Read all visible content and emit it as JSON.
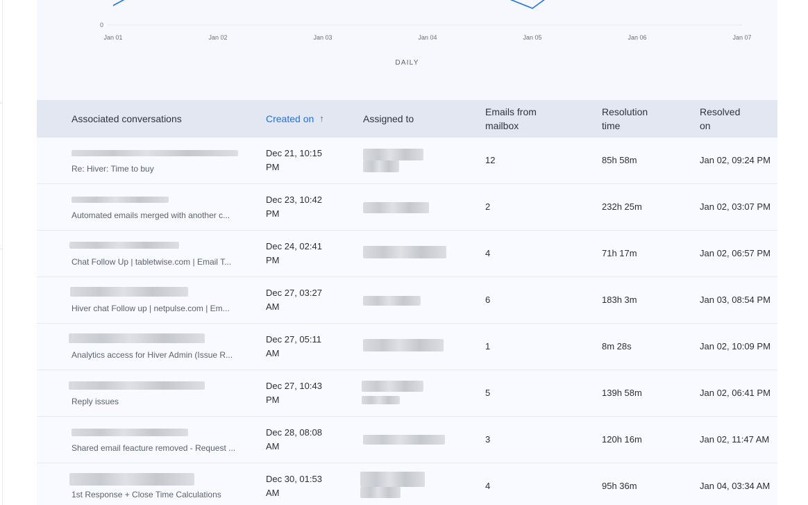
{
  "chart_data": {
    "type": "line",
    "x": [
      "Jan 01",
      "Jan 02",
      "Jan 03",
      "Jan 04",
      "Jan 05",
      "Jan 06",
      "Jan 07"
    ],
    "xlabel": "DAILY",
    "y_tick_labels": [
      "0"
    ],
    "series": [
      {
        "values": [
          1.5,
          null,
          null,
          null,
          0.4,
          null,
          null
        ]
      }
    ],
    "grid": "horizontal baseline",
    "line_color": "#1a73e8"
  },
  "table": {
    "columns": {
      "conversation": "Associated conversations",
      "created": "Created on",
      "assigned": "Assigned to",
      "emails": [
        "Emails from",
        "mailbox"
      ],
      "restime": [
        "Resolution",
        "time"
      ],
      "resolved": [
        "Resolved",
        "on"
      ]
    },
    "sort_icon": "arrow-up-icon",
    "rows": [
      {
        "subject": "Re: Hiver: Time to buy",
        "created": [
          "Dec 21, 10:15",
          "PM"
        ],
        "emails": "12",
        "restime": "85h 58m",
        "resolved": "Jan 02, 09:24 PM"
      },
      {
        "subject": "Automated emails merged with another c...",
        "created": [
          "Dec 23, 10:42",
          "PM"
        ],
        "emails": "2",
        "restime": "232h 25m",
        "resolved": "Jan 02, 03:07 PM"
      },
      {
        "subject": "Chat Follow Up | tabletwise.com | Email T...",
        "created": [
          "Dec 24, 02:41",
          "PM"
        ],
        "emails": "4",
        "restime": "71h 17m",
        "resolved": "Jan 02, 06:57 PM"
      },
      {
        "subject": "Hiver chat Follow up | netpulse.com | Em...",
        "created": [
          "Dec 27, 03:27",
          "AM"
        ],
        "emails": "6",
        "restime": "183h 3m",
        "resolved": "Jan 03, 08:54 PM"
      },
      {
        "subject": "Analytics access for Hiver Admin (Issue R...",
        "created": [
          "Dec 27, 05:11",
          "AM"
        ],
        "emails": "1",
        "restime": "8m 28s",
        "resolved": "Jan 02, 10:09 PM"
      },
      {
        "subject": "Reply issues",
        "created": [
          "Dec 27, 10:43",
          "PM"
        ],
        "emails": "5",
        "restime": "139h 58m",
        "resolved": "Jan 02, 06:41 PM"
      },
      {
        "subject": "Shared email feacture removed - Request ...",
        "created": [
          "Dec 28, 08:08",
          "AM"
        ],
        "emails": "3",
        "restime": "120h 16m",
        "resolved": "Jan 02, 11:47 AM"
      },
      {
        "subject": "1st Response + Close Time Calculations",
        "created": [
          "Dec 30, 01:53",
          "AM"
        ],
        "emails": "4",
        "restime": "95h 36m",
        "resolved": "Jan 04, 03:34 AM"
      }
    ]
  }
}
